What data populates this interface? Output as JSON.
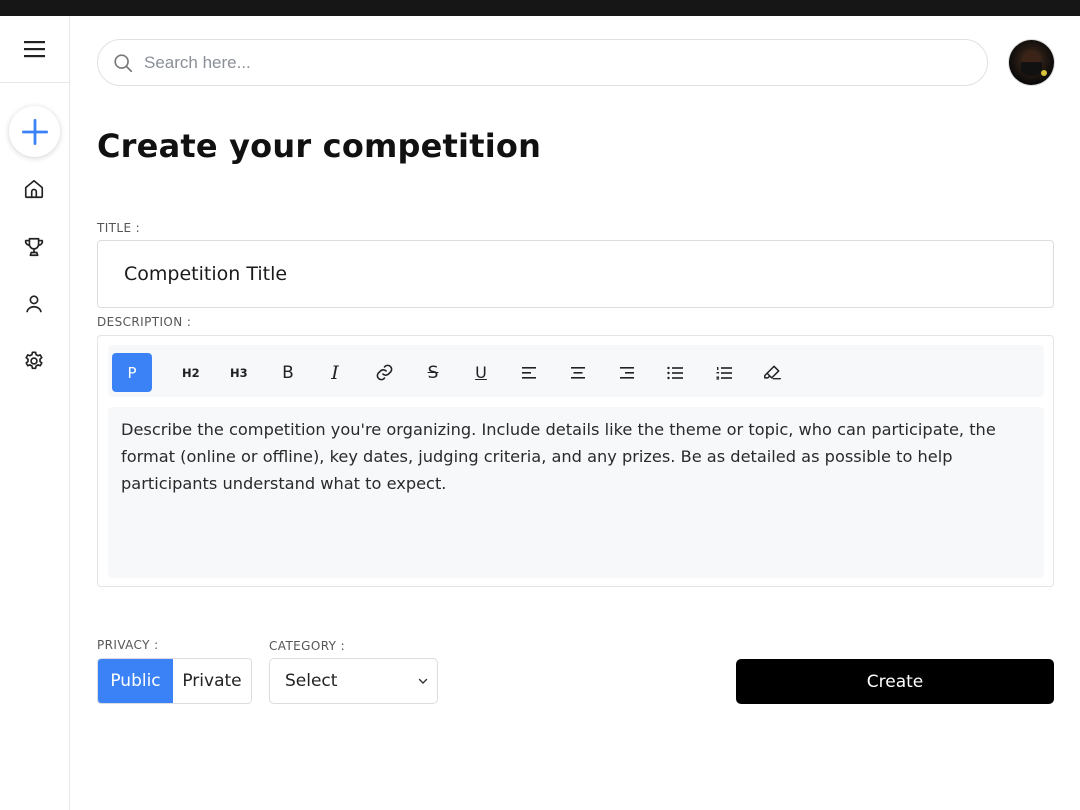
{
  "search": {
    "placeholder": "Search here..."
  },
  "page": {
    "title": "Create your competition"
  },
  "form": {
    "title_label": "TITLE :",
    "title_value": "Competition Title",
    "description_label": "DESCRIPTION :",
    "description_text": "Describe the competition you're organizing. Include details like the theme or topic, who can participate, the format (online or offline), key dates, judging criteria, and any prizes. Be as detailed as possible to help participants understand what to expect.",
    "privacy_label": "PRIVACY :",
    "privacy_public": "Public",
    "privacy_private": "Private",
    "privacy_selected": "Public",
    "category_label": "CATEGORY :",
    "category_value": "Select",
    "create_label": "Create"
  },
  "toolbar": {
    "paragraph": "P",
    "h2": "H2",
    "h3": "H3",
    "bold": "B",
    "italic": "I",
    "strike": "S",
    "underline": "U",
    "active": "paragraph"
  },
  "sidebar": {
    "items": [
      "hamburger-menu-icon",
      "add-icon",
      "home-icon",
      "trophy-icon",
      "user-icon",
      "settings-icon"
    ]
  },
  "colors": {
    "accent": "#3b82f6",
    "primary_button": "#000000",
    "topbar": "#161616"
  }
}
